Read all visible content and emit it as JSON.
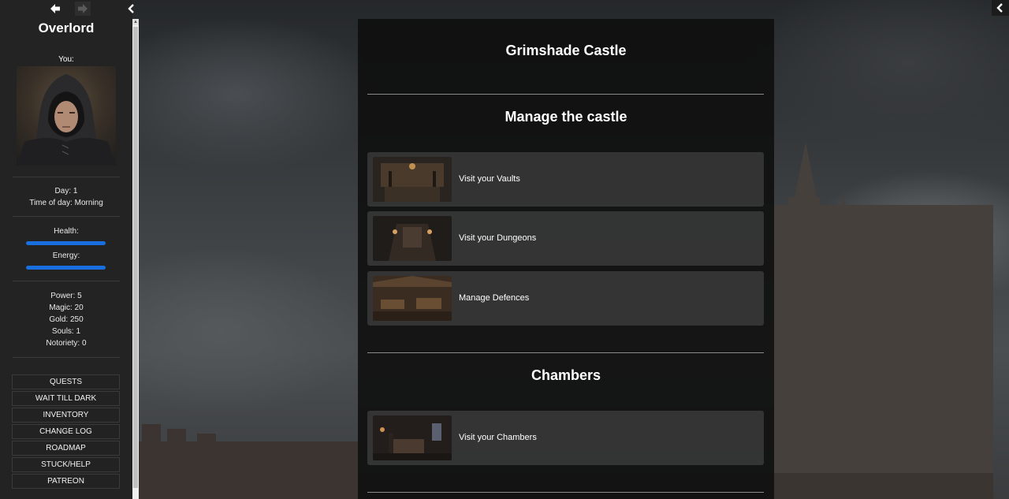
{
  "sidebar": {
    "game_title": "Overlord",
    "you_label": "You:",
    "day": "Day: 1",
    "time_of_day": "Time of day: Morning",
    "health_label": "Health:",
    "health": 1.0,
    "energy_label": "Energy:",
    "energy": 1.0,
    "stats": [
      "Power: 5",
      "Magic: 20",
      "Gold: 250",
      "Souls: 1",
      "Notoriety: 0"
    ],
    "menu": [
      "QUESTS",
      "WAIT TILL DARK",
      "INVENTORY",
      "CHANGE LOG",
      "ROADMAP",
      "STUCK/HELP",
      "PATREON"
    ]
  },
  "main": {
    "location_title": "Grimshade Castle",
    "section_manage": "Manage the castle",
    "manage_cards": [
      {
        "label": "Visit your Vaults"
      },
      {
        "label": "Visit your Dungeons"
      },
      {
        "label": "Manage Defences"
      }
    ],
    "section_chambers": "Chambers",
    "chamber_cards": [
      {
        "label": "Visit your Chambers"
      }
    ]
  },
  "colors": {
    "accent_bar": "#1a6fe0",
    "sidebar_bg": "#232323",
    "panel_bg": "#0e0e0e"
  }
}
